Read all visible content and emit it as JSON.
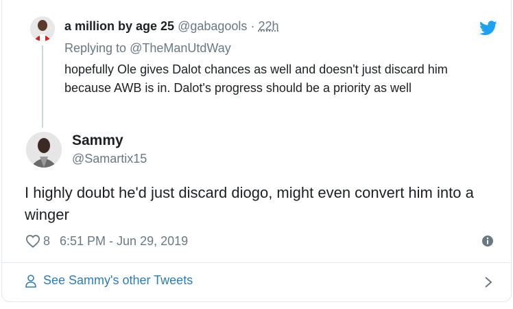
{
  "parent_tweet": {
    "display_name": "a million by age 25",
    "handle": "@gabagools",
    "separator": "·",
    "time_ago": "22h",
    "replying_prefix": "Replying to",
    "replying_to": "@TheManUtdWay",
    "text": "hopefully Ole gives Dalot chances as well and doesn't just discard him because AWB is in. Dalot's progress should be a priority as well",
    "icons": {
      "brand": "twitter-bird-icon",
      "avatar": "avatar-photo"
    }
  },
  "main_tweet": {
    "display_name": "Sammy",
    "handle": "@Samartix15",
    "text": "I highly doubt he'd just discard diogo, might even convert him into a winger",
    "likes": "8",
    "timestamp": "6:51 PM - Jun 29, 2019",
    "icons": {
      "like": "heart-icon",
      "info": "info-icon",
      "avatar": "avatar-photo"
    }
  },
  "footer": {
    "link_label": "See Sammy's other Tweets",
    "icons": {
      "leading": "person-icon",
      "trailing": "chevron-right-icon"
    }
  },
  "colors": {
    "text_primary": "#1c2022",
    "text_secondary": "#697882",
    "link_blue": "#2b7bb9",
    "twitter_blue": "#1da1f2",
    "border": "#e1e8ed"
  }
}
